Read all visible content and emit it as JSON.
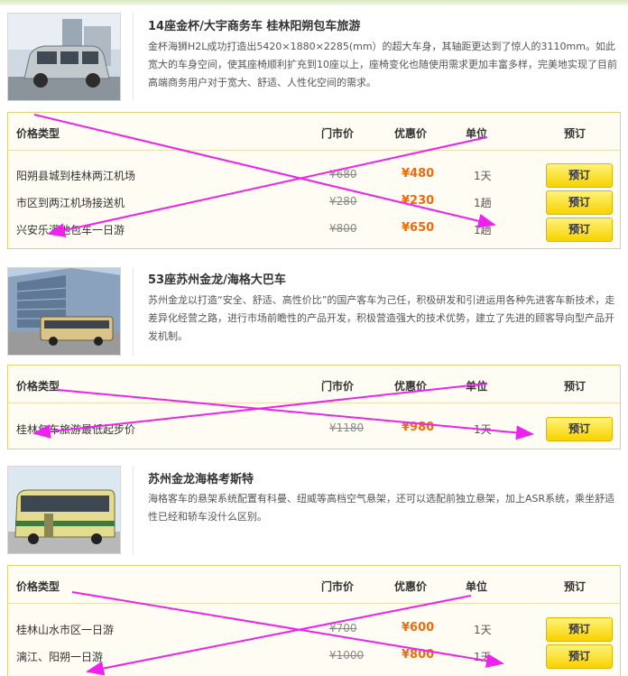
{
  "colors": {
    "accent": "#f06a0c",
    "button": "#f7d300",
    "annotation": "#ee22ee",
    "box_border": "#e4cf7a"
  },
  "table_headers": {
    "type": "价格类型",
    "orig": "门市价",
    "sale": "优惠价",
    "unit": "单位",
    "book": "预订"
  },
  "vehicles": [
    {
      "title": "14座金杯/大宇商务车 桂林阳朔包车旅游",
      "image": "minivan-photo",
      "desc": "金杯海狮H2L成功打造出5420×1880×2285(mm）的超大车身，其轴距更达到了惊人的3110mm。如此宽大的车身空间，使其座椅顺利扩充到10座以上，座椅变化也随使用需求更加丰富多样，完美地实现了目前高端商务用户对于宽大、舒适、人性化空间的需求。",
      "rows": [
        {
          "name": "阳朔县城到桂林两江机场",
          "orig": "¥680",
          "sale": "¥480",
          "unit": "1天",
          "book": "预订"
        },
        {
          "name": "市区到两江机场接送机",
          "orig": "¥280",
          "sale": "¥230",
          "unit": "1趟",
          "book": "预订"
        },
        {
          "name": "兴安乐满地包车一日游",
          "orig": "¥800",
          "sale": "¥650",
          "unit": "1趟",
          "book": "预订"
        }
      ]
    },
    {
      "title": "53座苏州金龙/海格大巴车",
      "image": "coach-bus-photo",
      "desc": "苏州金龙以打造“安全、舒适、高性价比”的国产客车为己任，积极研发和引进运用各种先进客车新技术，走差异化经营之路，进行市场前瞻性的产品开发，积极营造强大的技术优势，建立了先进的顾客导向型产品开发机制。",
      "rows": [
        {
          "name": "桂林包车旅游最低起步价",
          "orig": "¥1180",
          "sale": "¥980",
          "unit": "1天",
          "book": "预订"
        }
      ]
    },
    {
      "title": "苏州金龙海格考斯特",
      "image": "coaster-bus-photo",
      "desc": "海格客车的悬架系统配置有科曼、纽威等高档空气悬架，还可以选配前独立悬架，加上ASR系统，乘坐舒适性已经和轿车没什么区别。",
      "rows": [
        {
          "name": "桂林山水市区一日游",
          "orig": "¥700",
          "sale": "¥600",
          "unit": "1天",
          "book": "预订"
        },
        {
          "name": "漓江、阳朔一日游",
          "orig": "¥1000",
          "sale": "¥800",
          "unit": "1天",
          "book": "预订"
        }
      ]
    }
  ]
}
